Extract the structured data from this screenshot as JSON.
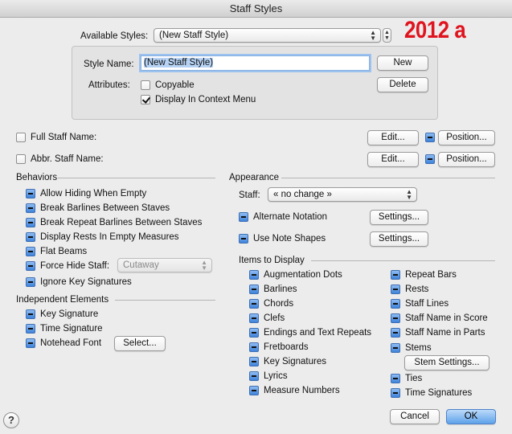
{
  "window": {
    "title": "Staff Styles"
  },
  "annotation": "2012 a",
  "available_styles": {
    "label": "Available Styles:",
    "value": "(New Staff Style)"
  },
  "style_name": {
    "label": "Style Name:",
    "value": "(New Staff Style)"
  },
  "buttons": {
    "new": "New",
    "delete": "Delete",
    "edit": "Edit...",
    "position": "Position...",
    "settings": "Settings...",
    "select": "Select...",
    "stem_settings": "Stem Settings...",
    "cancel": "Cancel",
    "ok": "OK"
  },
  "attributes": {
    "label": "Attributes:",
    "copyable": {
      "label": "Copyable",
      "checked": false
    },
    "display_in_context_menu": {
      "label": "Display In Context Menu",
      "checked": true
    }
  },
  "full_staff_name": {
    "label": "Full Staff Name:",
    "checked": false
  },
  "abbr_staff_name": {
    "label": "Abbr. Staff Name:",
    "checked": false
  },
  "behaviors": {
    "heading": "Behaviors",
    "items": [
      "Allow Hiding When Empty",
      "Break Barlines Between Staves",
      "Break Repeat Barlines Between Staves",
      "Display Rests In Empty Measures",
      "Flat Beams",
      "Force Hide Staff:",
      "Ignore Key Signatures"
    ],
    "force_hide_value": "Cutaway"
  },
  "independent_elements": {
    "heading": "Independent Elements",
    "items": [
      "Key Signature",
      "Time Signature",
      "Notehead Font"
    ]
  },
  "appearance": {
    "heading": "Appearance",
    "staff_label": "Staff:",
    "staff_value": "« no change »",
    "alternate_notation": "Alternate Notation",
    "use_note_shapes": "Use Note Shapes"
  },
  "items_to_display": {
    "heading": "Items to Display",
    "col1": [
      "Augmentation Dots",
      "Barlines",
      "Chords",
      "Clefs",
      "Endings and Text Repeats",
      "Fretboards",
      "Key Signatures",
      "Lyrics",
      "Measure Numbers"
    ],
    "col2": [
      "Repeat Bars",
      "Rests",
      "Staff Lines",
      "Staff Name in Score",
      "Staff Name in Parts",
      "Stems",
      "Ties",
      "Time Signatures"
    ]
  },
  "help": "?",
  "colors": {
    "annotation_red": "#e0141e",
    "default_button_blue": "#5fa2ea"
  }
}
